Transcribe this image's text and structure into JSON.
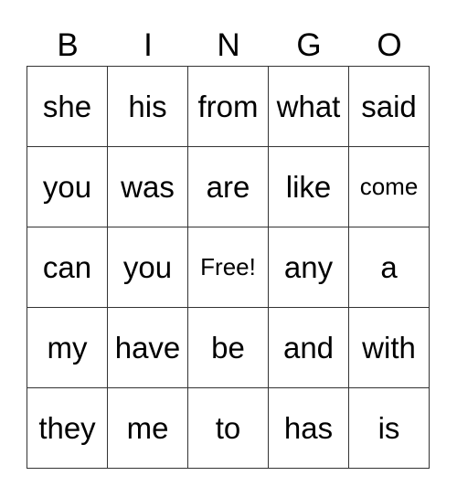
{
  "header": [
    "B",
    "I",
    "N",
    "G",
    "O"
  ],
  "rows": [
    [
      "she",
      "his",
      "from",
      "what",
      "said"
    ],
    [
      "you",
      "was",
      "are",
      "like",
      "come"
    ],
    [
      "can",
      "you",
      "Free!",
      "any",
      "a"
    ],
    [
      "my",
      "have",
      "be",
      "and",
      "with"
    ],
    [
      "they",
      "me",
      "to",
      "has",
      "is"
    ]
  ]
}
